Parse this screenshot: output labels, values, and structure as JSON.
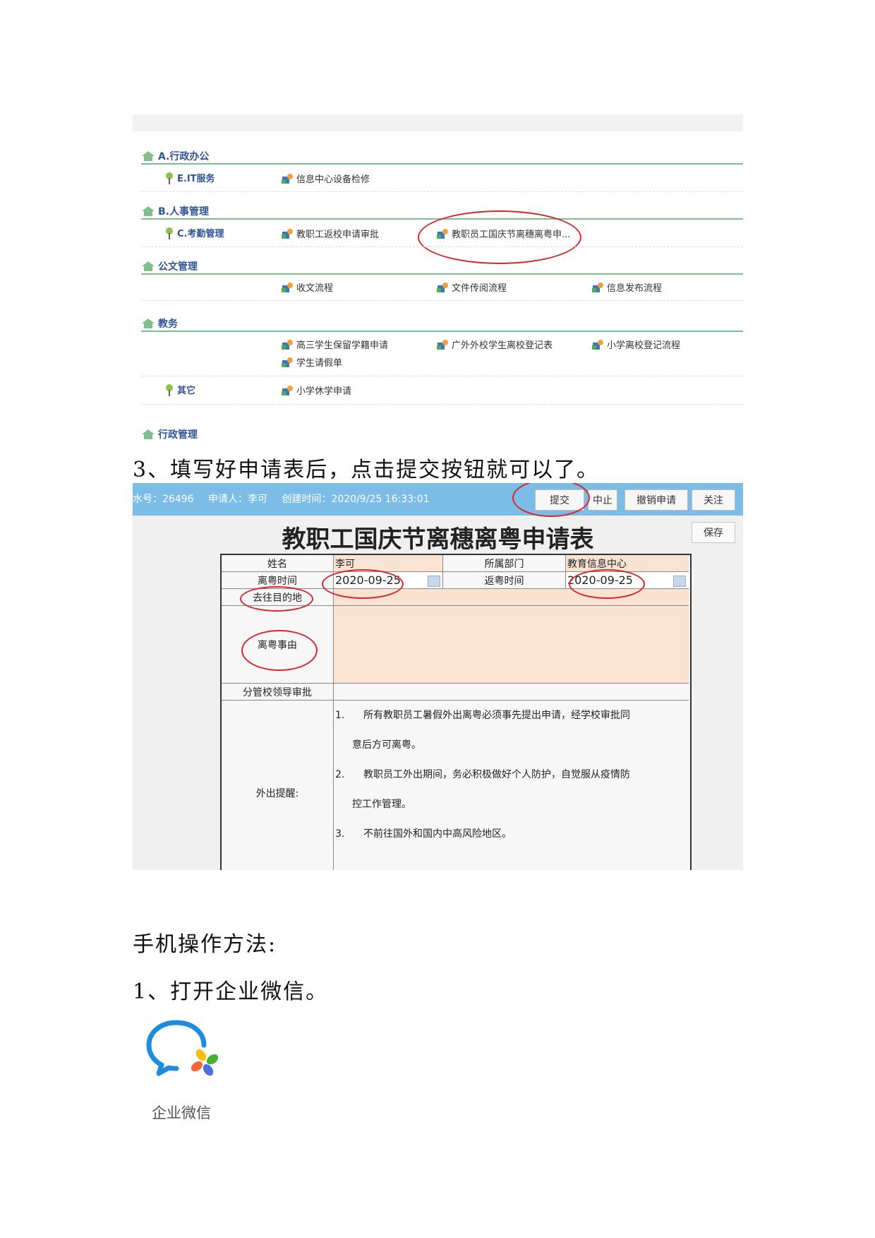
{
  "menu": {
    "categories": [
      {
        "title": "A.行政办公"
      },
      {
        "title": "B.人事管理"
      },
      {
        "title": "公文管理"
      },
      {
        "title": "教务"
      },
      {
        "title": "行政管理"
      }
    ],
    "subcategories": {
      "it": "E.IT服务",
      "kaoqin": "C.考勤管理",
      "other": "其它"
    },
    "flows": {
      "info_repair": "信息中心设备检修",
      "return_school": "教职工返校申请审批",
      "national_day": "教职员工国庆节离穗离粤申...",
      "receive_doc": "收文流程",
      "file_review": "文件传阅流程",
      "info_publish": "信息发布流程",
      "senior_keep": "高三学生保留学籍申请",
      "outside_student": "广外外校学生离校登记表",
      "primary_leave": "小学离校登记流程",
      "student_leave": "学生请假单",
      "primary_suspend": "小学休学申请"
    }
  },
  "doc": {
    "step3": "3、填写好申请表后，点击提交按钮就可以了。",
    "mobile_heading": "手机操作方法:",
    "step1": "1、打开企业微信。"
  },
  "form": {
    "info": {
      "serial": "水号：26496",
      "applicant": "申请人：李可",
      "created": "创建时间：2020/9/25 16:33:01"
    },
    "buttons": {
      "submit": "提交",
      "abort": "中止",
      "withdraw": "撤销申请",
      "follow": "关注",
      "save": "保存"
    },
    "title": "教职工国庆节离穗离粤申请表",
    "labels": {
      "name": "姓名",
      "dept": "所属部门",
      "leave_time": "离粤时间",
      "return_time": "返粤时间",
      "destination": "去往目的地",
      "reason": "离粤事由",
      "approval": "分管校领导审批",
      "reminder": "外出提醒:"
    },
    "values": {
      "name": "李可",
      "dept": "教育信息中心",
      "leave_date": "2020-09-25",
      "return_date": "2020-09-25"
    },
    "notes": {
      "n1_num": "1.",
      "n1_a": "所有教职员工暑假外出离粤必须事先提出申请，经学校审批同",
      "n1_b": "意后方可离粤。",
      "n2_num": "2.",
      "n2_a": "教职员工外出期间，务必积极做好个人防护，自觉服从疫情防",
      "n2_b": "控工作管理。",
      "n3_num": "3.",
      "n3_a": "不前往国外和国内中高风险地区。"
    }
  },
  "wecom": {
    "label": "企业微信",
    "colors": {
      "blue": "#1c8ce0",
      "green": "#46b035",
      "yellow": "#fbbd0b",
      "orange": "#f2683a",
      "purple": "#4a6fe3"
    }
  },
  "colors": {
    "highlight_ring": "#d9262b",
    "info_bar": "#7cbde8",
    "input_fill": "#fbe3d2",
    "category_line": "#7fbf8f"
  }
}
